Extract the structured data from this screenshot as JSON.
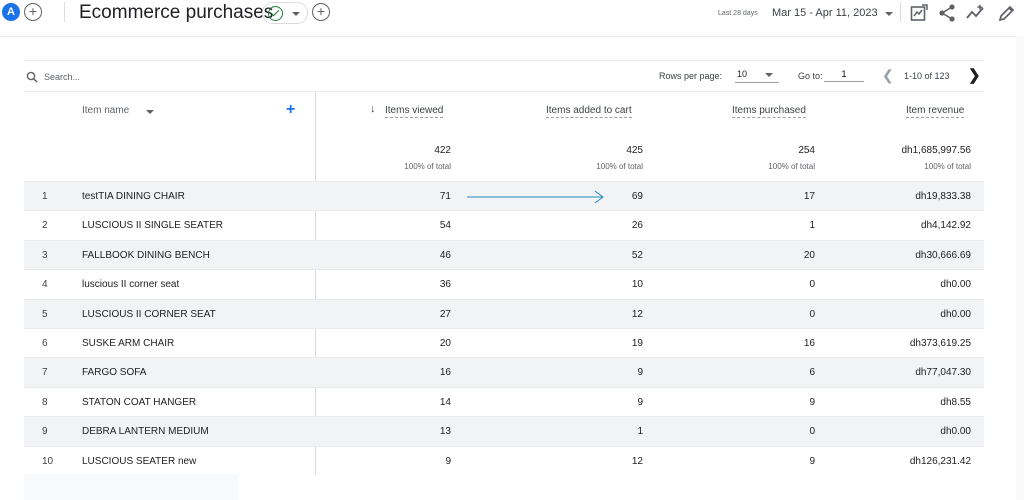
{
  "header": {
    "avatar_letter": "A",
    "title": "Ecommerce purchases",
    "date_label": "Last 28 days",
    "date_range": "Mar 15 - Apr 11, 2023",
    "icons": [
      "customize-report-icon",
      "share-icon",
      "insights-icon",
      "edit-icon"
    ]
  },
  "toolbar": {
    "search_placeholder": "Search...",
    "rows_per_page_label": "Rows per page:",
    "rows_per_page_value": "10",
    "goto_label": "Go to:",
    "goto_value": "1",
    "pager_info": "1-10 of 123"
  },
  "table": {
    "columns": {
      "item_name": "Item name",
      "items_viewed": "Items viewed",
      "items_added": "Items added to cart",
      "items_purchased": "Items purchased",
      "item_revenue": "Item revenue"
    },
    "totals": {
      "items_viewed": "422",
      "items_added": "425",
      "items_purchased": "254",
      "item_revenue": "dh1,685,997.56",
      "pct": "100% of total"
    },
    "rows": [
      {
        "idx": "1",
        "name": "testTIA DINING CHAIR",
        "viewed": "71",
        "added": "69",
        "purchased": "17",
        "revenue": "dh19,833.38"
      },
      {
        "idx": "2",
        "name": "LUSCIOUS II SINGLE SEATER",
        "viewed": "54",
        "added": "26",
        "purchased": "1",
        "revenue": "dh4,142.92"
      },
      {
        "idx": "3",
        "name": "FALLBOOK DINING BENCH",
        "viewed": "46",
        "added": "52",
        "purchased": "20",
        "revenue": "dh30,666.69"
      },
      {
        "idx": "4",
        "name": "luscious II corner seat",
        "viewed": "36",
        "added": "10",
        "purchased": "0",
        "revenue": "dh0.00"
      },
      {
        "idx": "5",
        "name": "LUSCIOUS II CORNER SEAT",
        "viewed": "27",
        "added": "12",
        "purchased": "0",
        "revenue": "dh0.00"
      },
      {
        "idx": "6",
        "name": "SUSKE ARM CHAIR",
        "viewed": "20",
        "added": "19",
        "purchased": "16",
        "revenue": "dh373,619.25"
      },
      {
        "idx": "7",
        "name": "FARGO SOFA",
        "viewed": "16",
        "added": "9",
        "purchased": "6",
        "revenue": "dh77,047.30"
      },
      {
        "idx": "8",
        "name": "STATON COAT HANGER",
        "viewed": "14",
        "added": "9",
        "purchased": "9",
        "revenue": "dh8.55"
      },
      {
        "idx": "9",
        "name": "DEBRA LANTERN MEDIUM",
        "viewed": "13",
        "added": "1",
        "purchased": "0",
        "revenue": "dh0.00"
      },
      {
        "idx": "10",
        "name": "LUSCIOUS SEATER new",
        "viewed": "9",
        "added": "12",
        "purchased": "9",
        "revenue": "dh126,231.42"
      }
    ]
  },
  "colors": {
    "accent": "#1a73e8",
    "success": "#188038",
    "annotation": "#1e88c8"
  }
}
